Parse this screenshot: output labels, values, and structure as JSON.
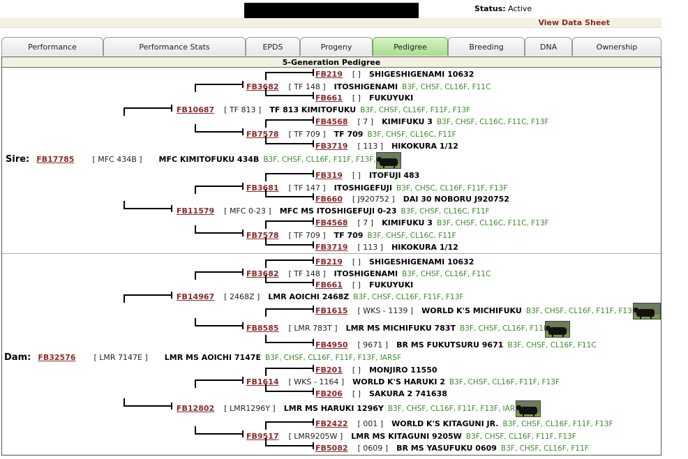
{
  "status": {
    "label": "Status:",
    "value": "Active"
  },
  "data_sheet_link": "View Data Sheet",
  "tabs": [
    {
      "label": "Performance",
      "active": false
    },
    {
      "label": "Performance Stats",
      "active": false
    },
    {
      "label": "EPDS",
      "active": false
    },
    {
      "label": "Progeny",
      "active": false
    },
    {
      "label": "Pedigree",
      "active": true
    },
    {
      "label": "Breeding",
      "active": false
    },
    {
      "label": "DNA",
      "active": false
    },
    {
      "label": "Ownership",
      "active": false
    }
  ],
  "pedigree": {
    "title": "5-Generation Pedigree",
    "sire_label": "Sire:",
    "dam_label": "Dam:",
    "entries": [
      {
        "reg": "FB219",
        "tag": "[ ]",
        "name": "SHIGESHIGENAMI 10632",
        "codes": ""
      },
      {
        "reg": "FB3682",
        "tag": "[ TF 148 ]",
        "name": "ITOSHIGENAMI",
        "codes": "B3F, CHSF, CL16F, F11C"
      },
      {
        "reg": "FB661",
        "tag": "[ ]",
        "name": "FUKUYUKI",
        "codes": ""
      },
      {
        "reg": "FB10687",
        "tag": "[ TF 813 ]",
        "name": "TF 813 KIMITOFUKU",
        "codes": "B3F, CHSF, CL16F, F11F, F13F"
      },
      {
        "reg": "FB4568",
        "tag": "[ 7 ]",
        "name": "KIMIFUKU 3",
        "codes": "B3F, CHSF, CL16C, F11C, F13F"
      },
      {
        "reg": "FB7578",
        "tag": "[ TF 709 ]",
        "name": "TF 709",
        "codes": "B3F, CHSF, CL16C, F11F"
      },
      {
        "reg": "FB3719",
        "tag": "[ 113 ]",
        "name": "HIKOKURA 1/12",
        "codes": ""
      },
      {
        "reg": "FB17785",
        "tag": "[ MFC 434B ]",
        "name": "MFC KIMITOFUKU 434B",
        "codes": "B3F, CHSF, CL16F, F11F, F13F, IARSF"
      },
      {
        "reg": "FB319",
        "tag": "[ ]",
        "name": "ITOFUJI 483",
        "codes": ""
      },
      {
        "reg": "FB3681",
        "tag": "[ TF 147 ]",
        "name": "ITOSHIGEFUJI",
        "codes": "B3F, CHSC, CL16F, F11F, F13F"
      },
      {
        "reg": "FB660",
        "tag": "[ J920752 ]",
        "name": "DAI 30 NOBORU J920752",
        "codes": ""
      },
      {
        "reg": "FB11579",
        "tag": "[ MFC 0-23 ]",
        "name": "MFC MS ITOSHIGEFUJI 0-23",
        "codes": "B3F, CHSF, CL16C, F11F"
      },
      {
        "reg": "FB4568",
        "tag": "[ 7 ]",
        "name": "KIMIFUKU 3",
        "codes": "B3F, CHSF, CL16C, F11C, F13F"
      },
      {
        "reg": "FB7578",
        "tag": "[ TF 709 ]",
        "name": "TF 709",
        "codes": "B3F, CHSF, CL16C, F11F"
      },
      {
        "reg": "FB3719",
        "tag": "[ 113 ]",
        "name": "HIKOKURA 1/12",
        "codes": ""
      },
      {
        "reg": "FB219",
        "tag": "[ ]",
        "name": "SHIGESHIGENAMI 10632",
        "codes": ""
      },
      {
        "reg": "FB3682",
        "tag": "[ TF 148 ]",
        "name": "ITOSHIGENAMI",
        "codes": "B3F, CHSF, CL16F, F11C"
      },
      {
        "reg": "FB661",
        "tag": "[ ]",
        "name": "FUKUYUKI",
        "codes": ""
      },
      {
        "reg": "FB14967",
        "tag": "[ 2468Z ]",
        "name": "LMR AOICHI 2468Z",
        "codes": "B3F, CHSF, CL16F, F11F, F13F"
      },
      {
        "reg": "FB1615",
        "tag": "[ WKS - 1139 ]",
        "name": "WORLD K'S MICHIFUKU",
        "codes": "B3F, CHSF, CL16F, F11F, F13F"
      },
      {
        "reg": "FB8585",
        "tag": "[ LMR 783T ]",
        "name": "LMR MS MICHIFUKU 783T",
        "codes": "B3F, CHSF, CL16F, F11F"
      },
      {
        "reg": "FB4950",
        "tag": "[ 9671 ]",
        "name": "BR MS FUKUTSURU 9671",
        "codes": "B3F, CHSF, CL16F, F11C"
      },
      {
        "reg": "FB32576",
        "tag": "[ LMR 7147E ]",
        "name": "LMR MS AOICHI 7147E",
        "codes": "B3F, CHSF, CL16F, F11F, F13F, IARSF"
      },
      {
        "reg": "FB201",
        "tag": "[ ]",
        "name": "MONJIRO 11550",
        "codes": ""
      },
      {
        "reg": "FB1614",
        "tag": "[ WKS - 1164 ]",
        "name": "WORLD K'S HARUKI 2",
        "codes": "B3F, CHSF, CL16F, F11F, F13F"
      },
      {
        "reg": "FB206",
        "tag": "[ ]",
        "name": "SAKURA 2 741638",
        "codes": ""
      },
      {
        "reg": "FB12802",
        "tag": "[ LMR1296Y ]",
        "name": "LMR MS HARUKI 1296Y",
        "codes": "B3F, CHSF, CL16F, F11F, F13F, IARSC"
      },
      {
        "reg": "FB2422",
        "tag": "[ 001 ]",
        "name": "WORLD K'S KITAGUNI JR.",
        "codes": "B3F, CHSF, CL16F, F11F, F13F"
      },
      {
        "reg": "FB9517",
        "tag": "[ LMR9205W ]",
        "name": "LMR MS KITAGUNI 9205W",
        "codes": "B3F, CHSF, CL16F, F11F, F13F"
      },
      {
        "reg": "FB5082",
        "tag": "[ 0609 ]",
        "name": "BR MS YASUFUKU 0609",
        "codes": "B3F, CHSF, CL16F, F11F"
      }
    ]
  }
}
